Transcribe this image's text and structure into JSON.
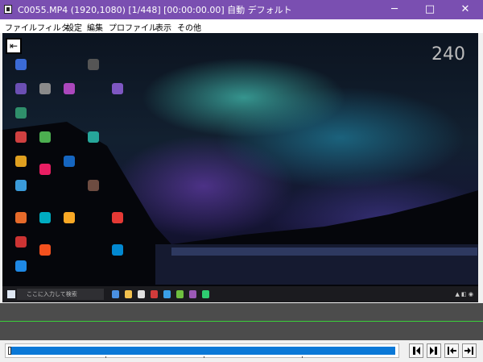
{
  "window": {
    "title": "C0055.MP4 (1920,1080)  [1/448] [00:00:00.00]  自動  デフォルト",
    "accent": "#7a4fb1",
    "controls": {
      "minimize": "─",
      "maximize": "□",
      "close": "✕"
    }
  },
  "menu": {
    "items": [
      "ファイル",
      "フィルタ",
      "設定",
      "編集",
      "プロファイル",
      "表示",
      "その他"
    ]
  },
  "preview": {
    "frame_counter": "240",
    "exit_icon": "exit-arrow-icon",
    "taskbar_search_placeholder": "ここに入力して検索"
  },
  "seekbar": {
    "progress_fraction": 1.0,
    "fill_color": "#0a78d7",
    "marker_color": "#3ad03a"
  },
  "controls": [
    "prev-frame-icon",
    "next-frame-icon",
    "go-start-icon",
    "go-end-icon"
  ]
}
